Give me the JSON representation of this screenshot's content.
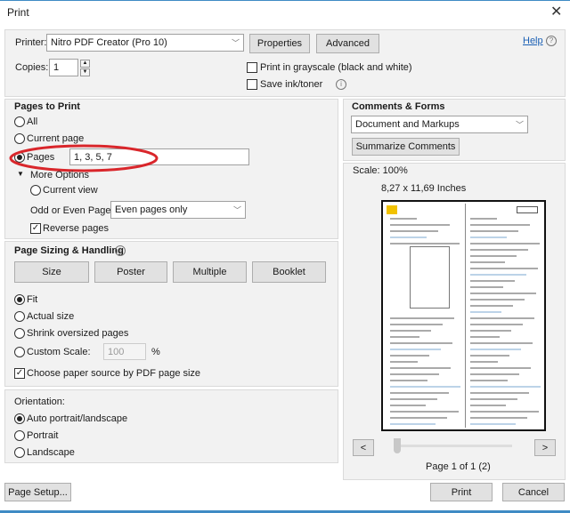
{
  "window": {
    "title": "Print",
    "close_icon": "close-icon"
  },
  "printer": {
    "label": "Printer:",
    "value": "Nitro PDF Creator (Pro 10)",
    "properties": "Properties",
    "advanced": "Advanced",
    "help": "Help"
  },
  "copies": {
    "label": "Copies:",
    "value": "1"
  },
  "options": {
    "grayscale": "Print in grayscale (black and white)",
    "grayscale_checked": false,
    "save_ink": "Save ink/toner",
    "save_ink_checked": false
  },
  "pages_to_print": {
    "title": "Pages to Print",
    "all": "All",
    "current_page": "Current page",
    "pages": "Pages",
    "pages_value": "1, 3, 5, 7",
    "selected": "Pages",
    "more_options": "More Options",
    "current_view": "Current view",
    "odd_even_label": "Odd or Even Pages:",
    "odd_even_value": "Even pages only",
    "reverse": "Reverse pages",
    "reverse_checked": true,
    "highlight_color": "#d9262b"
  },
  "sizing": {
    "title": "Page Sizing & Handling",
    "buttons": [
      "Size",
      "Poster",
      "Multiple",
      "Booklet"
    ],
    "fit": "Fit",
    "actual": "Actual size",
    "shrink": "Shrink oversized pages",
    "custom": "Custom Scale:",
    "custom_value": "100",
    "percent": "%",
    "selected": "Fit",
    "paper_source": "Choose paper source by PDF page size",
    "paper_source_checked": true
  },
  "orientation": {
    "title": "Orientation:",
    "auto": "Auto portrait/landscape",
    "portrait": "Portrait",
    "landscape": "Landscape",
    "selected": "Auto portrait/landscape"
  },
  "comments": {
    "title": "Comments & Forms",
    "value": "Document and Markups",
    "summarize": "Summarize Comments"
  },
  "preview": {
    "scale": "Scale: 100%",
    "dimensions": "8,27 x 11,69 Inches",
    "prev": "<",
    "next": ">",
    "page_status": "Page 1 of 1 (2)",
    "slider_position": 0
  },
  "footer": {
    "page_setup": "Page Setup...",
    "print": "Print",
    "cancel": "Cancel"
  }
}
